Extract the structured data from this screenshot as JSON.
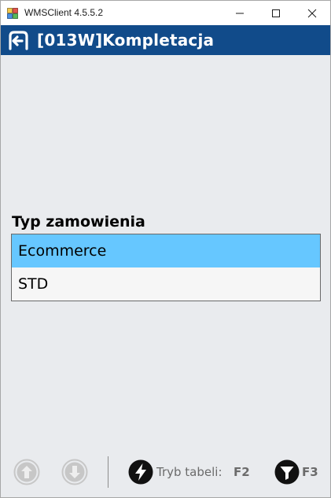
{
  "window": {
    "title": "WMSClient 4.5.5.2"
  },
  "header": {
    "title": "[013W]Kompletacja",
    "background": "#114b8a"
  },
  "order_type": {
    "label": "Typ zamowienia",
    "items": [
      {
        "label": "Ecommerce",
        "selected": true
      },
      {
        "label": "STD",
        "selected": false
      }
    ],
    "selected_color": "#66c7ff"
  },
  "toolbar": {
    "up_icon": "arrow-up-circle-icon",
    "down_icon": "arrow-down-circle-icon",
    "table_mode_label": "Tryb tabeli:",
    "table_mode_key": "F2",
    "filter_key": "F3"
  }
}
